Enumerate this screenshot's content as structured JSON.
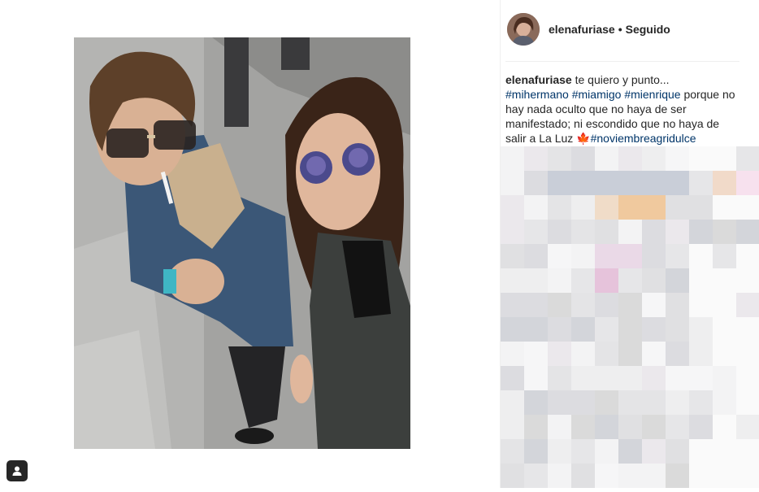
{
  "post": {
    "username": "elenafuriase",
    "separator": "•",
    "follow_status": "Seguido",
    "caption": {
      "author": "elenafuriase",
      "text_1": " te quiero y punto...",
      "hashtags": [
        "#mihermano",
        "#miamigo",
        "#mienrique"
      ],
      "text_2": " porque no hay nada oculto que no haya de ser manifestado; ni escondido que no haya de salir a La Luz ",
      "emoji": "🍁",
      "final_hashtag": "#noviembreagridulce"
    }
  },
  "icons": {
    "avatar": "profile-picture",
    "tag": "person-tag-icon",
    "leaf": "maple-leaf-emoji"
  },
  "colors": {
    "link": "#003569",
    "text": "#262626",
    "divider": "#efefef"
  }
}
